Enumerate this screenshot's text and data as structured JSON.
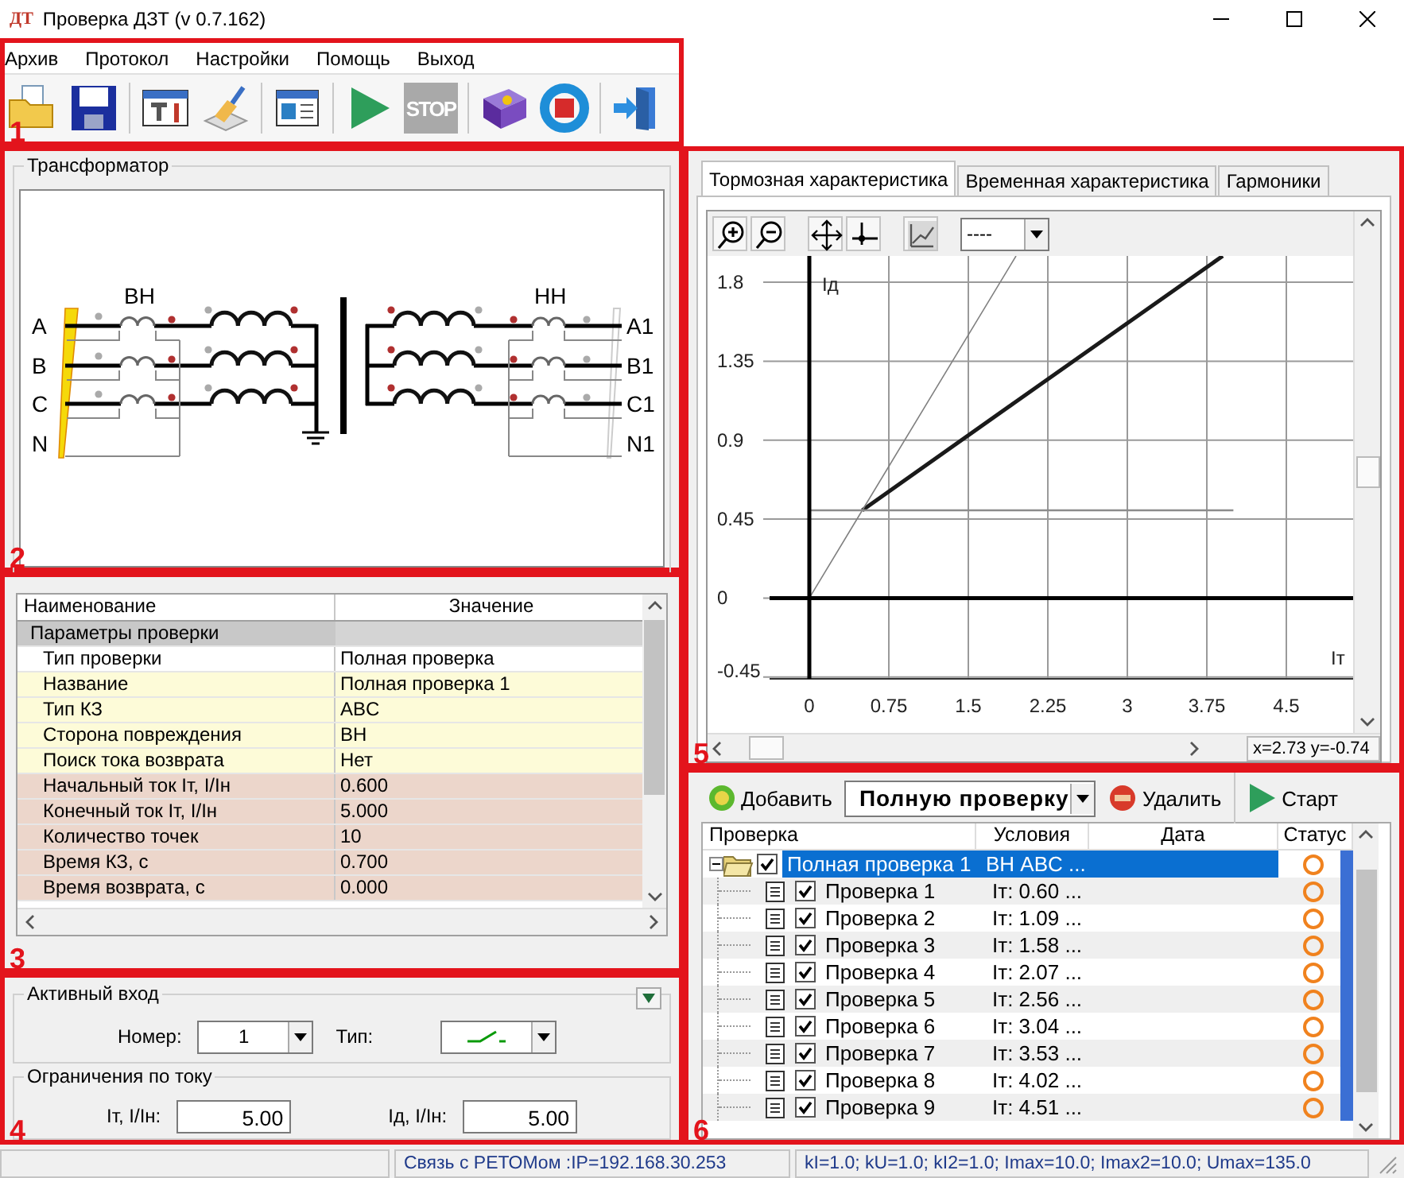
{
  "window": {
    "icon_text": "ДТ",
    "title": "Проверка ДЗТ (v 0.7.162)"
  },
  "main_toolbar": {
    "callout": "1",
    "menu": [
      "Архив",
      "Протокол",
      "Настройки",
      "Помощь",
      "Выход"
    ],
    "buttons": [
      {
        "kind": "open"
      },
      {
        "kind": "save"
      },
      {
        "kind": "separator"
      },
      {
        "kind": "settings"
      },
      {
        "kind": "clean"
      },
      {
        "kind": "separator"
      },
      {
        "kind": "window"
      },
      {
        "kind": "separator"
      },
      {
        "kind": "play"
      },
      {
        "kind": "stop",
        "label": "STOP"
      },
      {
        "kind": "separator"
      },
      {
        "kind": "help"
      },
      {
        "kind": "lifebuoy"
      },
      {
        "kind": "separator"
      },
      {
        "kind": "exit"
      }
    ]
  },
  "transformer": {
    "callout": "2",
    "title": "Трансформатор",
    "hv_label": "ВН",
    "lv_label": "НН",
    "hv_phases": [
      "A",
      "B",
      "C",
      "N"
    ],
    "lv_phases": [
      "A1",
      "B1",
      "C1",
      "N1"
    ]
  },
  "parameters": {
    "callout": "3",
    "columns": [
      "Наименование",
      "Значение"
    ],
    "category": "Параметры проверки",
    "rows": [
      {
        "name": "Тип проверки",
        "value": "Полная проверка",
        "color": "#ffffff"
      },
      {
        "name": "Название",
        "value": "Полная проверка 1",
        "color": "#fdfbd8"
      },
      {
        "name": "Тип КЗ",
        "value": "ABC",
        "color": "#fdfbd8"
      },
      {
        "name": "Сторона повреждения",
        "value": "ВН",
        "color": "#fdfbd8"
      },
      {
        "name": "Поиск тока возврата",
        "value": "Нет",
        "color": "#fdfbd8"
      },
      {
        "name": "Начальный ток Iт, I/Iн",
        "value": "0.600",
        "color": "#ecd6cb"
      },
      {
        "name": "Конечный ток Iт, I/Iн",
        "value": "5.000",
        "color": "#ecd6cb"
      },
      {
        "name": "Количество точек",
        "value": "10",
        "color": "#ecd6cb"
      },
      {
        "name": "Время КЗ, с",
        "value": "0.700",
        "color": "#ecd6cb"
      },
      {
        "name": "Время возврата, с",
        "value": "0.000",
        "color": "#ecd6cb"
      }
    ]
  },
  "inputs": {
    "callout": "4",
    "active_input": {
      "title": "Активный вход",
      "number_label": "Номер:",
      "number_value": "1",
      "type_label": "Тип:"
    },
    "current_limits": {
      "title": "Ограничения по току",
      "it_label": "Iт, I/Iн:",
      "it_value": "5.00",
      "id_label": "Iд, I/Iн:",
      "id_value": "5.00"
    }
  },
  "chart_panel": {
    "callout": "5",
    "tabs": [
      {
        "label": "Тормозная характеристика",
        "selected": true
      },
      {
        "label": "Временная характеристика",
        "selected": false
      },
      {
        "label": "Гармоники",
        "selected": false
      }
    ],
    "line_style": "----",
    "cursor_readout": "x=2.73  y=-0.74",
    "chart_data": {
      "type": "line",
      "xlabel": "Iт",
      "ylabel": "Iд",
      "x": [
        0,
        0.5,
        1.95,
        3.9,
        4.0
      ],
      "series": [
        {
          "color": "#1a1a1a",
          "values": [
            null,
            0.5,
            1.12,
            1.95,
            null
          ]
        },
        {
          "color": "#808080",
          "values": [
            0,
            0.5,
            1.95,
            null,
            null
          ]
        },
        {
          "color": "#8c8c8c",
          "values": [
            0.5,
            0.5,
            0.5,
            0.5,
            0.5
          ]
        }
      ],
      "xlim": [
        -0.375,
        5.13
      ],
      "ylim": [
        -0.46,
        1.95
      ],
      "xticks": [
        0,
        0.75,
        1.5,
        2.25,
        3,
        3.75,
        4.5
      ],
      "yticks": [
        -0.45,
        0,
        0.45,
        0.9,
        1.35,
        1.8
      ]
    }
  },
  "tests": {
    "callout": "6",
    "add_label": "Добавить",
    "test_type": "Полную проверку",
    "delete_label": "Удалить",
    "start_label": "Старт",
    "columns": [
      "Проверка",
      "Условия",
      "Дата",
      "Статус"
    ],
    "tree": [
      {
        "name": "Полная проверка 1",
        "conditions": "ВН ABC  ...",
        "selected": true,
        "expanded": true,
        "checked": true,
        "children": [
          {
            "name": "Проверка 1",
            "conditions": "Iт: 0.60  ...",
            "selected": false,
            "checked": true
          },
          {
            "name": "Проверка 2",
            "conditions": "Iт: 1.09  ...",
            "selected": false,
            "checked": true
          },
          {
            "name": "Проверка 3",
            "conditions": "Iт: 1.58  ...",
            "selected": false,
            "checked": true
          },
          {
            "name": "Проверка 4",
            "conditions": "Iт: 2.07  ...",
            "selected": false,
            "checked": true
          },
          {
            "name": "Проверка 5",
            "conditions": "Iт: 2.56  ...",
            "selected": false,
            "checked": true
          },
          {
            "name": "Проверка 6",
            "conditions": "Iт: 3.04  ...",
            "selected": false,
            "checked": true
          },
          {
            "name": "Проверка 7",
            "conditions": "Iт: 3.53  ...",
            "selected": false,
            "checked": true
          },
          {
            "name": "Проверка 8",
            "conditions": "Iт: 4.02  ...",
            "selected": false,
            "checked": true
          },
          {
            "name": "Проверка 9",
            "conditions": "Iт: 4.51  ...",
            "selected": false,
            "checked": true
          }
        ]
      }
    ]
  },
  "status_bar": {
    "connection": "Связь с РЕТОМом :IP=192.168.30.253",
    "coefficients": "kI=1.0; kU=1.0; kI2=1.0; Imax=10.0; Imax2=10.0; Umax=135.0"
  }
}
